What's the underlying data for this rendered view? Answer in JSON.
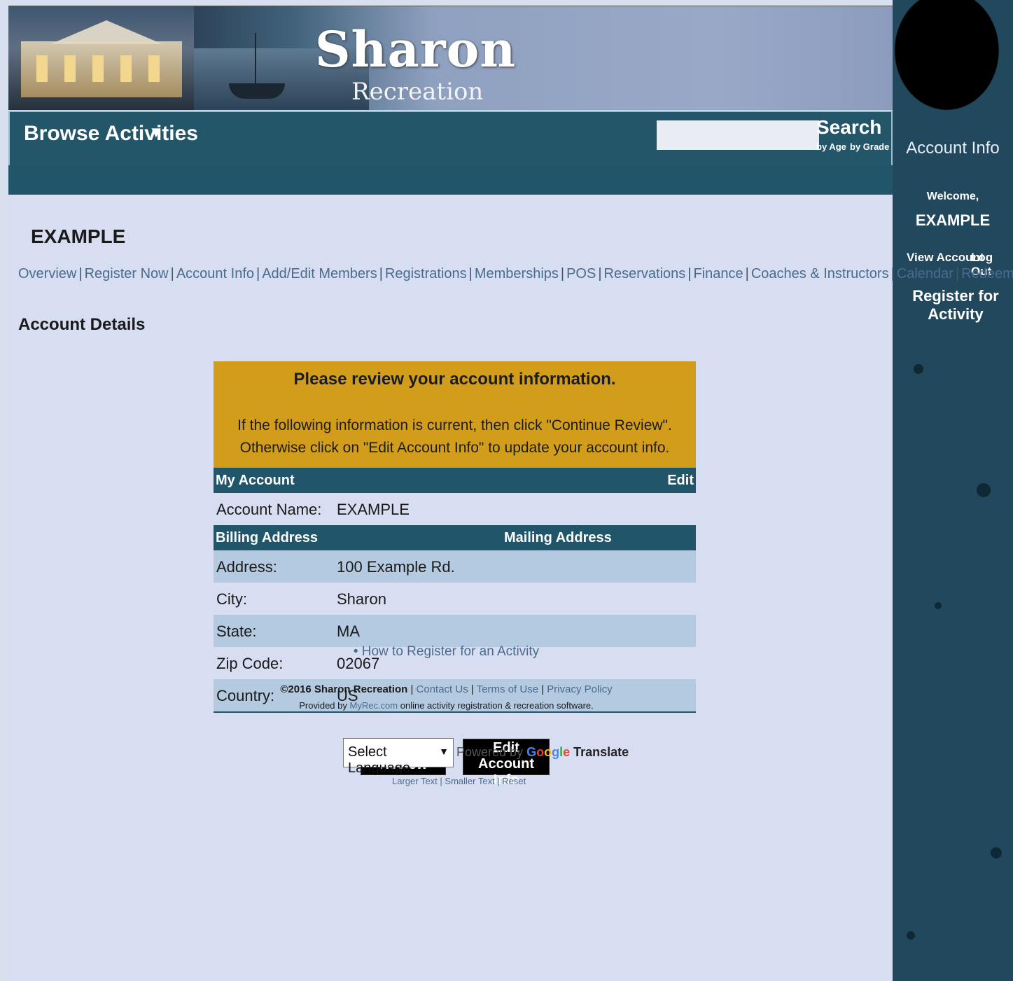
{
  "brand": {
    "title": "Sharon",
    "subtitle": "Recreation"
  },
  "nav": {
    "browse_label": "Browse Activities",
    "browse_arrow": "▼",
    "search_label": "Search",
    "by_age": "by Age",
    "by_grade": "by Grade",
    "search_value": ""
  },
  "sidebar": {
    "account_info": "Account Info",
    "welcome": "Welcome,",
    "user_name": "EXAMPLE",
    "view_account": "View Account",
    "log_out": "Log Out",
    "register_activity": "Register for Activity"
  },
  "main": {
    "account_title": "EXAMPLE",
    "subnav": [
      "Overview",
      "Register Now",
      "Account Info",
      "Add/Edit Members",
      "Registrations",
      "Memberships",
      "POS",
      "Reservations",
      "Finance",
      "Coaches & Instructors",
      "Calendar",
      "Redeem Gift"
    ],
    "section_title": "Account Details"
  },
  "review": {
    "heading": "Please review your account information.",
    "line1": "If the following information is current, then click \"Continue Review\".",
    "line2": "Otherwise click on \"Edit Account Info\" to update your account info."
  },
  "account_table": {
    "my_account": "My Account",
    "edit": "Edit",
    "account_name_label": "Account Name:",
    "account_name_value": "EXAMPLE",
    "billing_header": "Billing Address",
    "mailing_header": "Mailing Address",
    "rows": [
      {
        "label": "Address:",
        "value": "100 Example Rd."
      },
      {
        "label": "City:",
        "value": "Sharon"
      },
      {
        "label": "State:",
        "value": "MA"
      },
      {
        "label": "Zip Code:",
        "value": "02067"
      },
      {
        "label": "Country:",
        "value": "US"
      }
    ]
  },
  "buttons": {
    "continue": "Continue Review",
    "edit_account": "Edit Account Info"
  },
  "footer": {
    "how_to": "How to Register for an Activity",
    "copyright": "©2016 Sharon Recreation",
    "contact": "Contact Us",
    "terms": "Terms of Use",
    "privacy": "Privacy Policy",
    "provided_prefix": "Provided by",
    "provider_link": "MyRec.com",
    "provided_suffix": "online activity registration & recreation software."
  },
  "language": {
    "select_label": "Select Language",
    "powered_by": "Powered by",
    "google": "Google",
    "translate": "Translate",
    "text_controls": "Larger Text | Smaller Text | Reset"
  }
}
